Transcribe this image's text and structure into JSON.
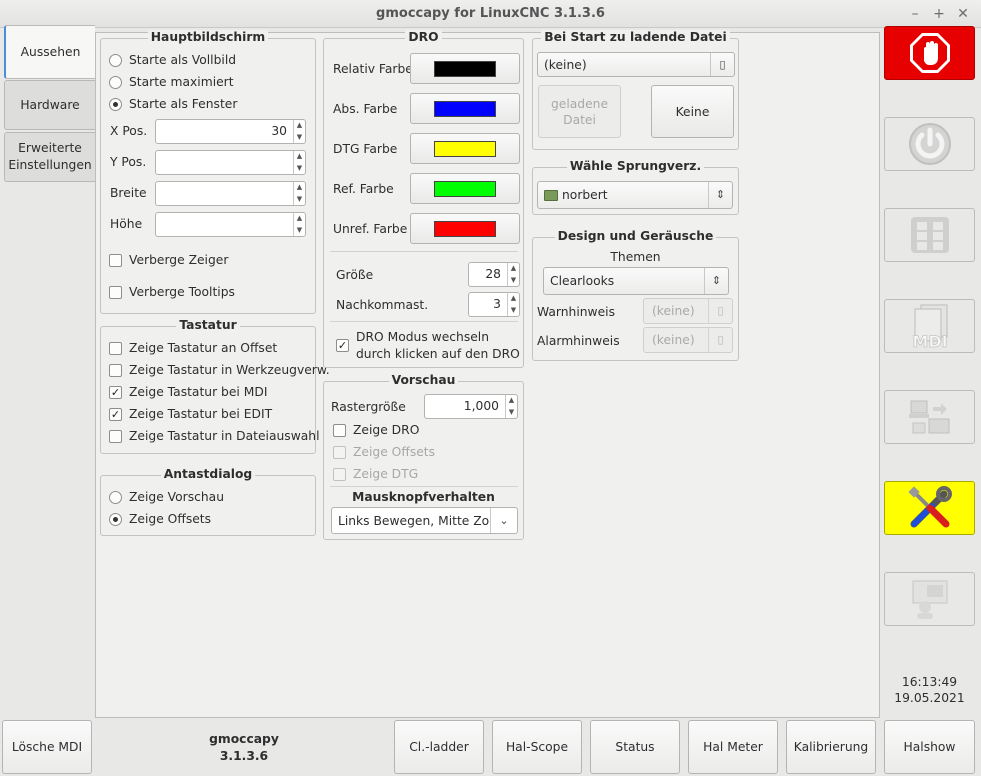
{
  "window": {
    "title": "gmoccapy for LinuxCNC  3.1.3.6"
  },
  "tabs": [
    {
      "label": "Aussehen"
    },
    {
      "label": "Hardware"
    },
    {
      "label": "Erweiterte Einstellungen"
    }
  ],
  "hauptbildschirm": {
    "title": "Hauptbildschirm",
    "opt_vollbild": "Starte als Vollbild",
    "opt_maximiert": "Starte maximiert",
    "opt_fenster": "Starte als Fenster",
    "xpos_label": "X Pos.",
    "xpos_value": "30",
    "ypos_label": "Y Pos.",
    "ypos_value": "",
    "breite_label": "Breite",
    "breite_value": "",
    "hoehe_label": "Höhe",
    "hoehe_value": "",
    "hide_pointer": "Verberge Zeiger",
    "hide_tooltips": "Verberge Tooltips"
  },
  "tastatur": {
    "title": "Tastatur",
    "items": [
      {
        "label": "Zeige Tastatur an Offset",
        "checked": false
      },
      {
        "label": "Zeige Tastatur in Werkzeugverw.",
        "checked": false
      },
      {
        "label": "Zeige Tastatur bei MDI",
        "checked": true
      },
      {
        "label": "Zeige Tastatur bei EDIT",
        "checked": true
      },
      {
        "label": "Zeige Tastatur in Dateiauswahl",
        "checked": false
      }
    ]
  },
  "antastdialog": {
    "title": "Antastdialog",
    "opt_vorschau": "Zeige Vorschau",
    "opt_offsets": "Zeige Offsets"
  },
  "dro": {
    "title": "DRO",
    "colors": [
      {
        "label": "Relativ Farbe",
        "color": "#000000"
      },
      {
        "label": "Abs. Farbe",
        "color": "#0000ff"
      },
      {
        "label": "DTG Farbe",
        "color": "#ffff00"
      },
      {
        "label": "Ref. Farbe",
        "color": "#00ff00"
      },
      {
        "label": "Unref. Farbe",
        "color": "#ff0000"
      }
    ],
    "size_label": "Größe",
    "size_value": "28",
    "digits_label": "Nachkommast.",
    "digits_value": "3",
    "toggle_label_1": "DRO Modus wechseln",
    "toggle_label_2": "durch klicken auf den DRO"
  },
  "vorschau": {
    "title": "Vorschau",
    "grid_label": "Rastergröße",
    "grid_value": "1,000",
    "show_dro": "Zeige DRO",
    "show_offsets": "Zeige Offsets",
    "show_dtg": "Zeige DTG",
    "mouse_title": "Mausknopfverhalten",
    "mouse_value": "Links Bewegen,  Mitte Zoom"
  },
  "startfile": {
    "title": "Bei Start zu ladende Datei",
    "value": "(keine)",
    "loaded_1": "geladene",
    "loaded_2": "Datei",
    "none_button": "Keine"
  },
  "jumpdir": {
    "title": "Wähle Sprungverz.",
    "value": "norbert"
  },
  "design": {
    "title": "Design und Geräusche",
    "themes_label": "Themen",
    "theme_value": "Clearlooks",
    "warn_label": "Warnhinweis",
    "warn_value": "(keine)",
    "alarm_label": "Alarmhinweis",
    "alarm_value": "(keine)"
  },
  "side": {
    "time": "16:13:49",
    "date": "19.05.2021",
    "mdi_text": "MDI"
  },
  "bottom": {
    "clear_mdi": "Lösche MDI",
    "app_name": "gmoccapy",
    "app_version": "3.1.3.6",
    "buttons": [
      "Cl.-ladder",
      "Hal-Scope",
      "Status",
      "Hal Meter",
      "Kalibrierung",
      "Halshow"
    ]
  }
}
